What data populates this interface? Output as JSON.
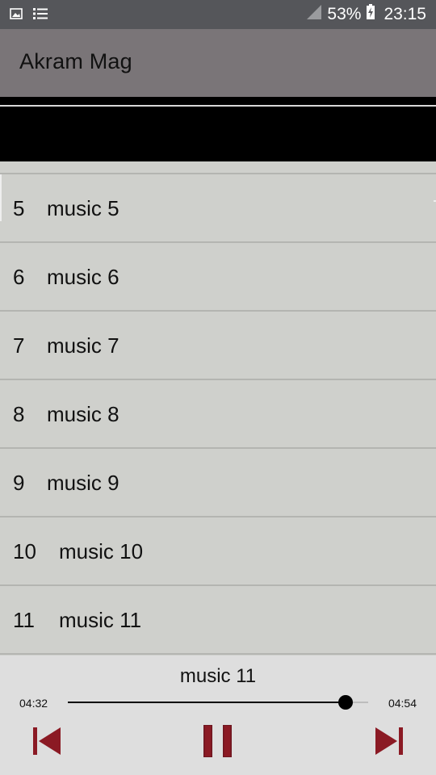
{
  "status_bar": {
    "icons": [
      "image-icon",
      "list-notification-icon",
      "signal-icon",
      "battery-charging-icon"
    ],
    "battery": "53%",
    "time": "23:15"
  },
  "app_bar": {
    "title": "Akram Mag"
  },
  "songs": [
    {
      "number": "5",
      "title": "music 5"
    },
    {
      "number": "6",
      "title": "music 6"
    },
    {
      "number": "7",
      "title": "music 7"
    },
    {
      "number": "8",
      "title": "music 8"
    },
    {
      "number": "9",
      "title": "music 9"
    },
    {
      "number": "10",
      "title": "music 10"
    },
    {
      "number": "11",
      "title": "music 11"
    }
  ],
  "player": {
    "now_playing": "music 11",
    "elapsed": "04:32",
    "total": "04:54",
    "progress": 0.925,
    "controls": [
      "previous-icon",
      "pause-icon",
      "next-icon"
    ]
  },
  "colors": {
    "status_bar": "#55565a",
    "app_bar": "#7a7578",
    "list_background": "#cfd0cc",
    "player_background": "#dedede",
    "control_accent": "#8b1a24"
  }
}
